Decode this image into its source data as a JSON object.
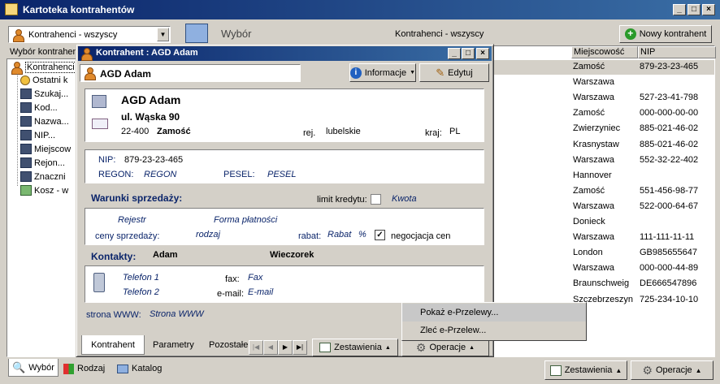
{
  "app": {
    "title": "Kartoteka kontrahentów"
  },
  "left": {
    "filter_value": "Kontrahenci - wszyscy",
    "header": "Wybór kontrahen",
    "tree_root": "Kontrahenci",
    "tree_items": [
      "Ostatni k",
      "Szukaj...",
      "Kod...",
      "Nazwa...",
      "NIP...",
      "Miejscow",
      "Rejon...",
      "Znaczni",
      "Kosz - w"
    ],
    "bottom_tabs": [
      "Wybór",
      "Rodzaj",
      "Katalog"
    ]
  },
  "main": {
    "header_title": "Wybór",
    "header_subtitle": "Kontrahenci - wszyscy",
    "new_button": "Nowy kontrahent",
    "columns": [
      "Miejscowość",
      "NIP"
    ],
    "rows": [
      {
        "city": "Zamość",
        "nip": "879-23-23-465"
      },
      {
        "city": "Warszawa",
        "nip": ""
      },
      {
        "city": "Warszawa",
        "nip": "527-23-41-798"
      },
      {
        "city": "Zamość",
        "nip": "000-000-00-00"
      },
      {
        "city": "Zwierzyniec",
        "nip": "885-021-46-02"
      },
      {
        "city": "Krasnystaw",
        "nip": "885-021-46-02"
      },
      {
        "city": "Warszawa",
        "nip": "552-32-22-402"
      },
      {
        "city": "Hannover",
        "nip": ""
      },
      {
        "city": "Zamość",
        "nip": "551-456-98-77"
      },
      {
        "city": "Warszawa",
        "nip": "522-000-64-67"
      },
      {
        "city": "Donieck",
        "nip": ""
      },
      {
        "city": "Warszawa",
        "nip": "111-111-11-11"
      },
      {
        "city": "London",
        "nip": "GB985655647"
      },
      {
        "city": "Warszawa",
        "nip": "000-000-44-89"
      },
      {
        "city": "Braunschweig",
        "nip": "DE666547896"
      },
      {
        "city": "Szczebrzeszyn",
        "nip": "725-234-10-10"
      }
    ],
    "zestawienia": "Zestawienia",
    "operacje": "Operacje"
  },
  "dialog": {
    "title": "Kontrahent : AGD Adam",
    "name_field": "AGD Adam",
    "informacje": "Informacje",
    "edytuj": "Edytuj",
    "address": {
      "name": "AGD Adam",
      "street": "ul. Wąska 90",
      "postcode": "22-400",
      "city": "Zamość",
      "region_label": "rej.",
      "region": "lubelskie",
      "country_label": "kraj:",
      "country": "PL"
    },
    "ids": {
      "nip_label": "NIP:",
      "nip": "879-23-23-465",
      "regon_label": "REGON:",
      "regon": "REGON",
      "pesel_label": "PESEL:",
      "pesel": "PESEL"
    },
    "sales": {
      "heading": "Warunki sprzedaży:",
      "credit_label": "limit kredytu:",
      "credit_value": "Kwota",
      "register": "Rejestr",
      "payment": "Forma płatności",
      "prices_label": "ceny sprzedaży:",
      "prices_value": "rodzaj",
      "discount_label": "rabat:",
      "discount_value": "Rabat",
      "percent": "%",
      "negotiation_label": "negocjacja cen"
    },
    "contacts": {
      "heading": "Kontakty:",
      "first_name": "Adam",
      "last_name": "Wieczorek",
      "phone1": "Telefon 1",
      "phone2": "Telefon 2",
      "fax_label": "fax:",
      "fax": "Fax",
      "email_label": "e-mail:",
      "email": "E-mail"
    },
    "www_label": "strona WWW:",
    "www": "Strona WWW",
    "tabs": [
      "Kontrahent",
      "Parametry",
      "Pozostałe"
    ],
    "zestawienia": "Zestawienia",
    "operacje": "Operacje"
  },
  "context_menu": {
    "items": [
      "Pokaż e-Przelewy...",
      "Zleć e-Przelew..."
    ]
  }
}
